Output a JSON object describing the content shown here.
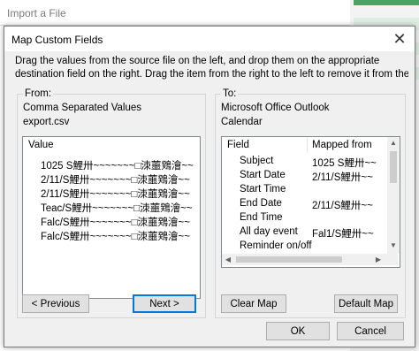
{
  "background": {
    "title": "Import a File"
  },
  "dialog": {
    "title": "Map Custom Fields",
    "close_glyph": "✕",
    "instructions_line1": "Drag the values from the source file on the left, and drop them on the appropriate",
    "instructions_line2": "destination field on the right.  Drag the item from the right to the left to remove it from the",
    "from": {
      "label": "From:",
      "type": "Comma Separated Values",
      "file": "export.csv",
      "column_header": "Value",
      "rows": [
        "1025 S鯉卅~~~~~~~□洓蘁䳫澮~~",
        "2/11/S鯉卅~~~~~~~□洓蘁䳫澮~~",
        "2/11/S鯉卅~~~~~~~□洓蘁䳫澮~~",
        "Teac/S鯉卅~~~~~~~□洓蘁䳫澮~~",
        "Falc/S鯉卅~~~~~~~□洓蘁䳫澮~~",
        "Falc/S鯉卅~~~~~~~□洓蘁䳫澮~~"
      ]
    },
    "to": {
      "label": "To:",
      "app": "Microsoft Office Outlook",
      "folder": "Calendar",
      "col_field": "Field",
      "col_mapped": "Mapped from",
      "rows": [
        {
          "field": "Subject",
          "mapped": "1025 S鯉卅~~"
        },
        {
          "field": "Start Date",
          "mapped": "2/11/S鯉卅~~"
        },
        {
          "field": "Start Time",
          "mapped": ""
        },
        {
          "field": "End Date",
          "mapped": "2/11/S鯉卅~~"
        },
        {
          "field": "End Time",
          "mapped": ""
        },
        {
          "field": "All day event",
          "mapped": "Fal1/S鯉卅~~"
        },
        {
          "field": "Reminder on/off",
          "mapped": ""
        }
      ]
    },
    "buttons": {
      "previous": "< Previous",
      "next": "Next >",
      "clear_map": "Clear Map",
      "default_map": "Default Map",
      "ok": "OK",
      "cancel": "Cancel"
    }
  },
  "colors": {
    "accent": "#0078d7",
    "green": "#4aa564"
  }
}
